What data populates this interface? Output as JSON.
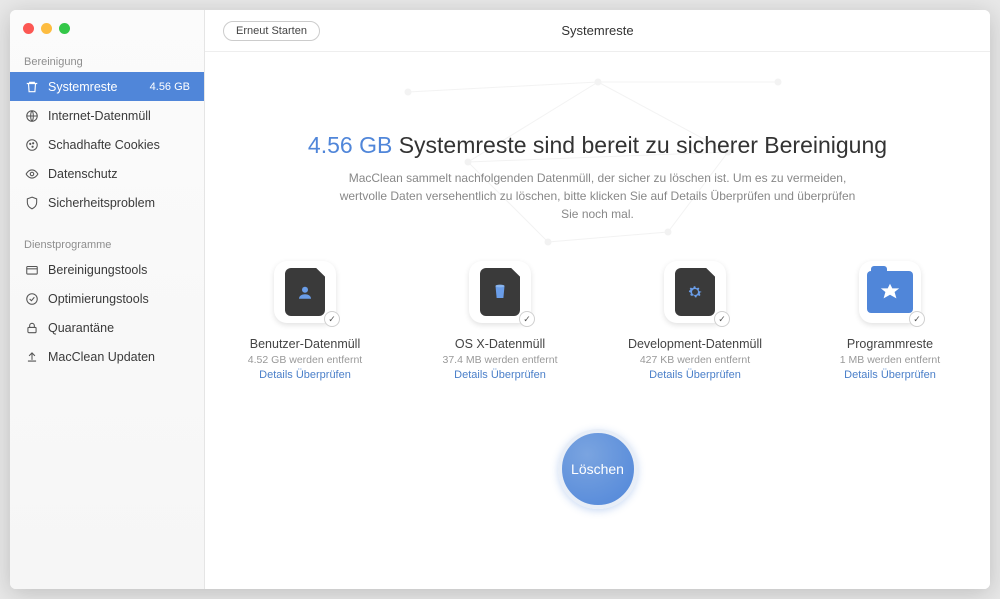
{
  "header": {
    "restart": "Erneut Starten",
    "title": "Systemreste"
  },
  "sidebar": {
    "section1": "Bereinigung",
    "section2": "Dienstprogramme",
    "items1": [
      {
        "label": "Systemreste",
        "badge": "4.56 GB",
        "icon": "trash-icon"
      },
      {
        "label": "Internet-Datenmüll",
        "badge": "",
        "icon": "globe-icon"
      },
      {
        "label": "Schadhafte Cookies",
        "badge": "",
        "icon": "cookie-icon"
      },
      {
        "label": "Datenschutz",
        "badge": "",
        "icon": "eye-icon"
      },
      {
        "label": "Sicherheitsproblem",
        "badge": "",
        "icon": "shield-icon"
      }
    ],
    "items2": [
      {
        "label": "Bereinigungstools",
        "badge": "",
        "icon": "folder-icon"
      },
      {
        "label": "Optimierungstools",
        "badge": "",
        "icon": "check-icon"
      },
      {
        "label": "Quarantäne",
        "badge": "",
        "icon": "lock-icon"
      },
      {
        "label": "MacClean Updaten",
        "badge": "",
        "icon": "upload-icon"
      }
    ]
  },
  "main": {
    "size": "4.56 GB",
    "headline_rest": " Systemreste sind bereit zu sicherer Bereinigung",
    "description": "MacClean sammelt nachfolgenden Datenmüll, der sicher zu löschen ist. Um es zu vermeiden, wertvolle Daten versehentlich zu löschen, bitte klicken Sie auf Details Überprüfen und überprüfen Sie noch mal.",
    "categories": [
      {
        "title": "Benutzer-Datenmüll",
        "size": "4.52 GB werden entfernt",
        "link": "Details Überprüfen",
        "icon": "user"
      },
      {
        "title": "OS X-Datenmüll",
        "size": "37.4 MB werden entfernt",
        "link": "Details Überprüfen",
        "icon": "trash"
      },
      {
        "title": "Development-Datenmüll",
        "size": "427 KB werden entfernt",
        "link": "Details Überprüfen",
        "icon": "gear"
      },
      {
        "title": "Programmreste",
        "size": "1 MB werden entfernt",
        "link": "Details Überprüfen",
        "icon": "app"
      }
    ],
    "delete": "Löschen"
  }
}
